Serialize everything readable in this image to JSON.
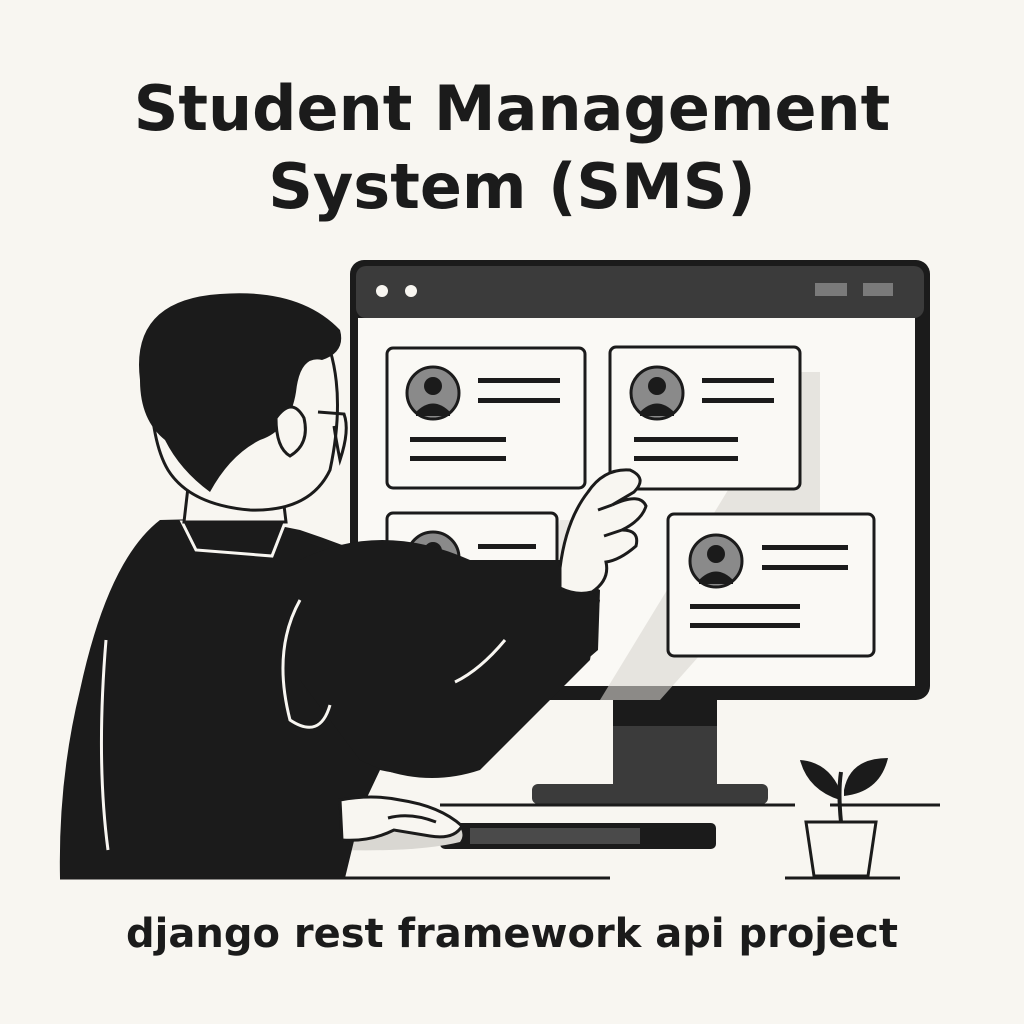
{
  "heading": {
    "line1": "Student Management",
    "line2": "System (SMS)"
  },
  "caption": "django rest framework api project",
  "illustration": {
    "subject": "person-at-monitor",
    "monitor": {
      "window_buttons": [
        "dot",
        "dot"
      ],
      "cards": [
        {
          "name": "student-card-1",
          "icon": "avatar-icon"
        },
        {
          "name": "student-card-2",
          "icon": "avatar-icon"
        },
        {
          "name": "student-card-3",
          "icon": "avatar-icon"
        },
        {
          "name": "student-card-4",
          "icon": "avatar-icon"
        }
      ]
    },
    "colors": {
      "background": "#f8f6f1",
      "ink": "#1b1b1b",
      "gray": "#7a7a7a",
      "card": "#faf9f5"
    }
  }
}
